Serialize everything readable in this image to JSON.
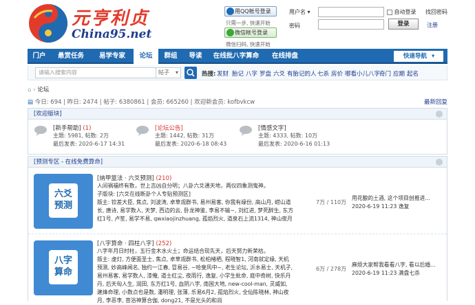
{
  "header": {
    "logo_text": "元亨利贞",
    "logo_domain": "China95.net",
    "qq_login": "用QQ帐号登录",
    "qq_note": "只需一步, 快速开始",
    "wechat_login": "微信帐号登录",
    "wechat_note": "微信扫码, 快速开始",
    "username_label": "用户名",
    "password_label": "密码",
    "auto_login": "自动登录",
    "forgot": "找回密码",
    "login_btn": "登录",
    "register": "注册"
  },
  "nav": {
    "items": [
      "门户",
      "悬赏任务",
      "易学专家",
      "论坛",
      "群组",
      "导读",
      "在线批八字算命",
      "在线排盘"
    ],
    "quick": "快速导航"
  },
  "search": {
    "placeholder": "请输入搜索内容",
    "scope": "帖子",
    "hot_label": "热搜:",
    "hot_words": [
      "发财",
      "胎记",
      "八字",
      "罗盘",
      "六爻",
      "有胎记的人",
      "七杀",
      "房价",
      "哪看小儿八字",
      "奇门",
      "应期",
      "起名"
    ]
  },
  "breadcrumb": {
    "current": "论坛"
  },
  "stats": {
    "text": "今日: 694 | 昨日: 2474 | 帖子: 6380861 | 会员: 665260 | 欢迎新会员: kofbvkcw",
    "latest_reply": "最新回复"
  },
  "welcome_box": {
    "title": "[欢迎版块]",
    "forums": [
      {
        "name": "[新手帮助]",
        "new": "(1)",
        "stats": "主题: 5981, 帖数: 2万",
        "last": "最后发表: 2020-6-17 14:31"
      },
      {
        "name": "[论坛公告]",
        "new": "",
        "stats": "主题: 1442, 帖数: 31万",
        "last": "最后发表: 2020-6-18 08:43"
      },
      {
        "name": "[情感文字]",
        "new": "",
        "stats": "主题: 4333, 帖数: 10万",
        "last": "最后发表: 2020-6-16 01:13"
      }
    ]
  },
  "predict_box": {
    "title": "[预测专区 - 在线免费算命]",
    "rows": [
      {
        "icon_text": [
          "六爻",
          "预测"
        ],
        "title": "[纳甲筮法 · 六爻预测]",
        "count": "(210)",
        "desc": "人间祸福终有数，世上吉凶自分明；八卦六爻通天地，两仪四象测鬼神。",
        "sub": "子版块: [六爻在线断卦个人专贴预测区]",
        "mods": "版主: 钦差大臣, 焦点, 刘波涛, 卓草观群书, 易州易客, 你我有缘份, 高山月, 崂山道长, 唐诗, 易学数人, 天梦, 西边的云, 卧龙神鉴, 李易不输~, 刘红进, 梦死醉生, 东方红1号, 卢笙, 易学不易, qwxiaojinzhuang, 孤焰烈火, 道泉石上流1314, 神山夜月",
        "posts": "7万 / 110万",
        "last_title": "用花酿的土酒, 这个项目创推进...",
        "last_meta": "2020-6-19 11:23 逸复"
      },
      {
        "icon_text": [
          "八字",
          "算命"
        ],
        "title": "[八字算命 · 四柱八字]",
        "count": "(252)",
        "desc": "八字年月日时柱，五行金木水火土；命运结合现先天，后天努力新荣枯。",
        "sub": "",
        "mods": "版主: 虚灯, 方便面圣士, 焦点, 卓草观群书, 松柏楮栖, 程晓智1, 河南就定缘, 天机预测, 妙高峰闻名, 独约一江春, 冒易谷, ~哈斐风中~, 老生论坛, 沂水易士, 天机子, 易州易客, 易学数人, 漆俺, 道士红尘, 夜雨行, 逸复, 小学生批命, 庭中奇树, 快乐丹丹, 后天匈人生, 润田, 东方红1号, 血阴八字, 南国大地, new-cool-man, 灵威如, 建烽命理, 小数点也是数, 潘明理, 张薄, 乐易6月2, 孤焰烈火, 全仙陈晓林, 神山夜月, 李恶李, 菩浴神算合伽, dong21, 不是光头的和尚",
        "posts": "6万 / 278万",
        "last_title": "麻烦大家帮我看看八字, 看以后婚...",
        "last_meta": "2020-6-19 11:23 满盘七杀"
      }
    ]
  },
  "colors": {
    "brand_blue": "#1f6ab1",
    "logo_red": "#e23b2c",
    "link_red": "#d9302b"
  }
}
